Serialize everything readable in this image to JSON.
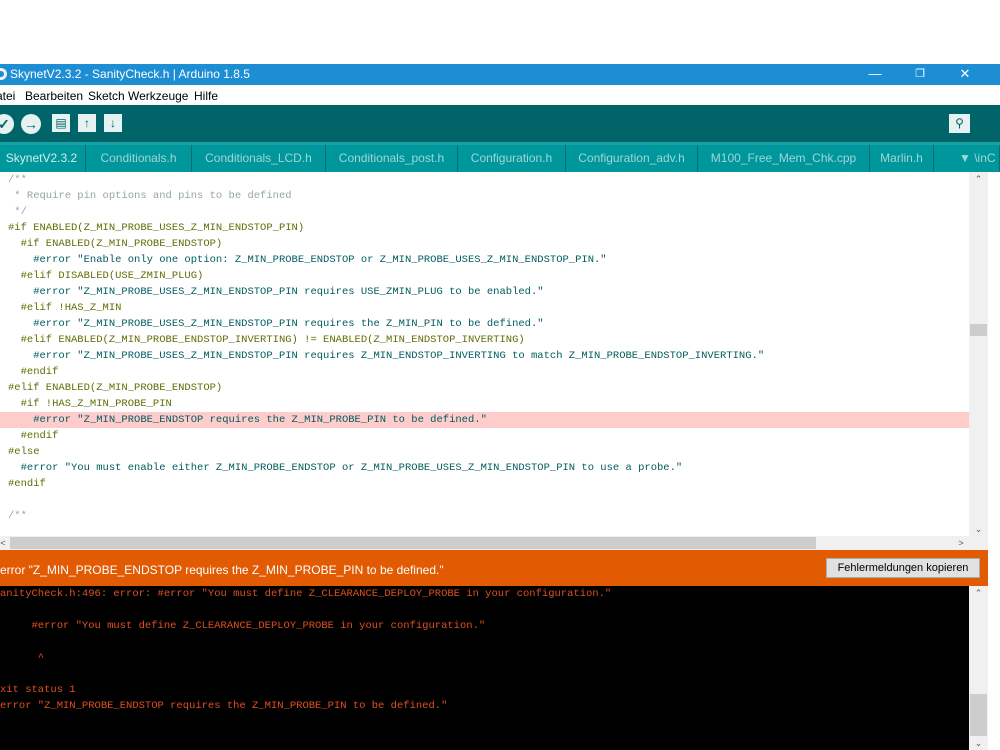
{
  "window": {
    "title": "SkynetV2.3.2 - SanityCheck.h | Arduino 1.8.5",
    "minimize": "—",
    "maximize": "❐",
    "close": "✕"
  },
  "menu": [
    "atei",
    "Bearbeiten",
    "Sketch",
    "Werkzeuge",
    "Hilfe"
  ],
  "toolbar": {
    "verify": "✓",
    "upload": "→",
    "new": "▤",
    "open": "↑",
    "save": "↓",
    "serial_monitor": "⚲"
  },
  "tabs": [
    "SkynetV2.3.2",
    "Conditionals.h",
    "Conditionals_LCD.h",
    "Conditionals_post.h",
    "Configuration.h",
    "Configuration_adv.h",
    "M100_Free_Mem_Chk.cpp",
    "Marlin.h",
    "▼ \\inC"
  ],
  "editor": {
    "lines": [
      "/**",
      " * Require pin options and pins to be defined",
      " */",
      "#if ENABLED(Z_MIN_PROBE_USES_Z_MIN_ENDSTOP_PIN)",
      "  #if ENABLED(Z_MIN_PROBE_ENDSTOP)",
      "    #error \"Enable only one option: Z_MIN_PROBE_ENDSTOP or Z_MIN_PROBE_USES_Z_MIN_ENDSTOP_PIN.\"",
      "  #elif DISABLED(USE_ZMIN_PLUG)",
      "    #error \"Z_MIN_PROBE_USES_Z_MIN_ENDSTOP_PIN requires USE_ZMIN_PLUG to be enabled.\"",
      "  #elif !HAS_Z_MIN",
      "    #error \"Z_MIN_PROBE_USES_Z_MIN_ENDSTOP_PIN requires the Z_MIN_PIN to be defined.\"",
      "  #elif ENABLED(Z_MIN_PROBE_ENDSTOP_INVERTING) != ENABLED(Z_MIN_ENDSTOP_INVERTING)",
      "    #error \"Z_MIN_PROBE_USES_Z_MIN_ENDSTOP_PIN requires Z_MIN_ENDSTOP_INVERTING to match Z_MIN_PROBE_ENDSTOP_INVERTING.\"",
      "  #endif",
      "#elif ENABLED(Z_MIN_PROBE_ENDSTOP)",
      "  #if !HAS_Z_MIN_PROBE_PIN",
      "    #error \"Z_MIN_PROBE_ENDSTOP requires the Z_MIN_PROBE_PIN to be defined.\"",
      "  #endif",
      "#else",
      "  #error \"You must enable either Z_MIN_PROBE_ENDSTOP or Z_MIN_PROBE_USES_Z_MIN_ENDSTOP_PIN to use a probe.\"",
      "#endif",
      "",
      "/**"
    ],
    "highlighted_line": 15
  },
  "error_bar": {
    "message": "error \"Z_MIN_PROBE_ENDSTOP requires the Z_MIN_PROBE_PIN to be defined.\"",
    "copy_button": "Fehlermeldungen kopieren"
  },
  "console": {
    "lines": [
      "anityCheck.h:496: error: #error \"You must define Z_CLEARANCE_DEPLOY_PROBE in your configuration.\"",
      "",
      "     #error \"You must define Z_CLEARANCE_DEPLOY_PROBE in your configuration.\"",
      "",
      "      ^",
      "",
      "xit status 1",
      "error \"Z_MIN_PROBE_ENDSTOP requires the Z_MIN_PROBE_PIN to be defined.\""
    ]
  },
  "colors": {
    "title_bar": "#1e8ed4",
    "toolbar": "#006468",
    "tab_bar": "#17a1a5",
    "error_bar": "#e25a02",
    "error_line_highlight": "#ffcccc",
    "console_bg": "#000000",
    "console_text": "#e05020"
  }
}
